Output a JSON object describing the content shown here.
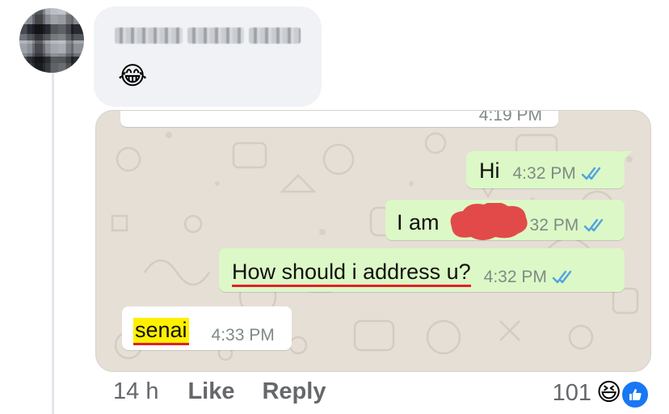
{
  "comment": {
    "emoji": "😂"
  },
  "chat": {
    "previous_time": "4:19 PM",
    "messages": [
      {
        "text": "Hi",
        "time": "4:32 PM"
      },
      {
        "text": "I am",
        "time": "32 PM"
      },
      {
        "text": "How should i address u?",
        "time": "4:32 PM"
      },
      {
        "text": "senai",
        "time": "4:33 PM"
      }
    ],
    "wallpaper_color": "#e6dfd6",
    "outgoing_color": "#dcf8c6",
    "tick_color": "#4fa3e0"
  },
  "footer": {
    "time_ago": "14 h",
    "like": "Like",
    "reply": "Reply"
  },
  "reactions": {
    "count": "101",
    "emoji": "😆",
    "like_icon": "thumbs-up-icon"
  }
}
